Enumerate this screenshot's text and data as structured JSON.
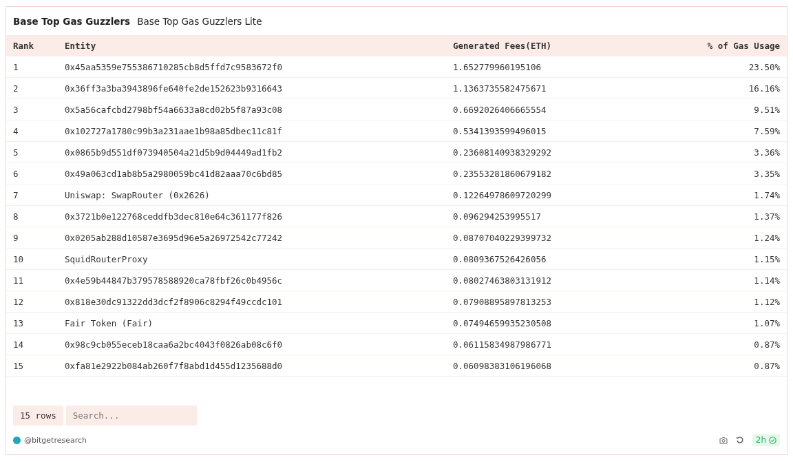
{
  "tabs": [
    {
      "label": "Base Top Gas Guzzlers",
      "selected": true
    },
    {
      "label": "Base Top Gas Guzzlers Lite",
      "selected": false
    }
  ],
  "table": {
    "columns": [
      "Rank",
      "Entity",
      "Generated Fees(ETH)",
      "% of Gas Usage"
    ],
    "rows": [
      [
        "1",
        "0x45aa5359e755386710285cb8d5ffd7c9583672f0",
        "1.652779960195106",
        "23.50%"
      ],
      [
        "2",
        "0x36ff3a3ba3943896fe640fe2de152623b9316643",
        "1.1363735582475671",
        "16.16%"
      ],
      [
        "3",
        "0x5a56cafcbd2798bf54a6633a8cd02b5f87a93c08",
        "0.6692026406665554",
        "9.51%"
      ],
      [
        "4",
        "0x102727a1780c99b3a231aae1b98a85dbec11c81f",
        "0.5341393599496015",
        "7.59%"
      ],
      [
        "5",
        "0x0865b9d551df073940504a21d5b9d04449ad1fb2",
        "0.23608140938329292",
        "3.36%"
      ],
      [
        "6",
        "0x49a063cd1ab8b5a2980059bc41d82aaa70c6bd85",
        "0.23553281860679182",
        "3.35%"
      ],
      [
        "7",
        "Uniswap: SwapRouter (0x2626)",
        "0.12264978609720299",
        "1.74%"
      ],
      [
        "8",
        "0x3721b0e122768ceddfb3dec810e64c361177f826",
        "0.096294253995517",
        "1.37%"
      ],
      [
        "9",
        "0x0205ab288d10587e3695d96e5a26972542c77242",
        "0.08707040229399732",
        "1.24%"
      ],
      [
        "10",
        "SquidRouterProxy",
        "0.0809367526426056",
        "1.15%"
      ],
      [
        "11",
        "0x4e59b44847b379578588920ca78fbf26c0b4956c",
        "0.08027463803131912",
        "1.14%"
      ],
      [
        "12",
        "0x818e30dc91322dd3dcf2f8906c8294f49ccdc101",
        "0.07908895897813253",
        "1.12%"
      ],
      [
        "13",
        "Fair Token (Fair)",
        "0.07494659935230508",
        "1.07%"
      ],
      [
        "14",
        "0x98c9cb055eceb18caa6a2bc4043f0826ab08c6f0",
        "0.06115834987986771",
        "0.87%"
      ],
      [
        "15",
        "0xfa81e2922b084ab260f7f8abd1d455d1235688d0",
        "0.06098383106196068",
        "0.87%"
      ]
    ]
  },
  "footer": {
    "row_count": "15 rows",
    "search": {
      "placeholder": "Search..."
    }
  },
  "attribution": "@bitgetresearch",
  "freshness": "2h"
}
